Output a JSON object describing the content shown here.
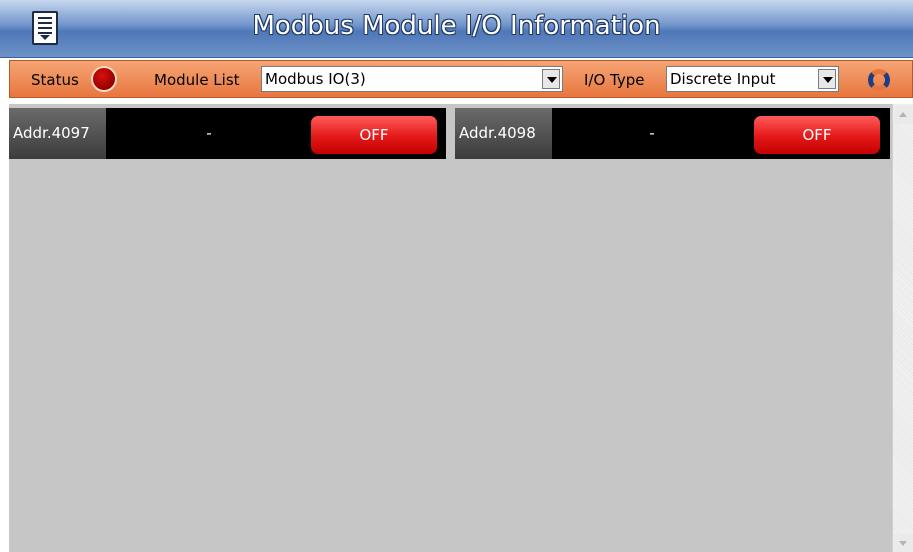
{
  "header": {
    "title": "Modbus Module I/O Information",
    "menu_icon": "menu-icon"
  },
  "toolbar": {
    "status_label": "Status",
    "status_color": "#b00000",
    "module_list_label": "Module List",
    "module_list_value": "Modbus IO(3)",
    "io_type_label": "I/O Type",
    "io_type_value": "Discrete Input",
    "refresh_icon": "refresh-icon",
    "background": "#e8763f"
  },
  "io_points": [
    {
      "address": "Addr.4097",
      "value": "-",
      "state": "OFF"
    },
    {
      "address": "Addr.4098",
      "value": "-",
      "state": "OFF"
    }
  ],
  "colors": {
    "off_button": "#e31818",
    "content_bg": "#c6c6c6"
  }
}
